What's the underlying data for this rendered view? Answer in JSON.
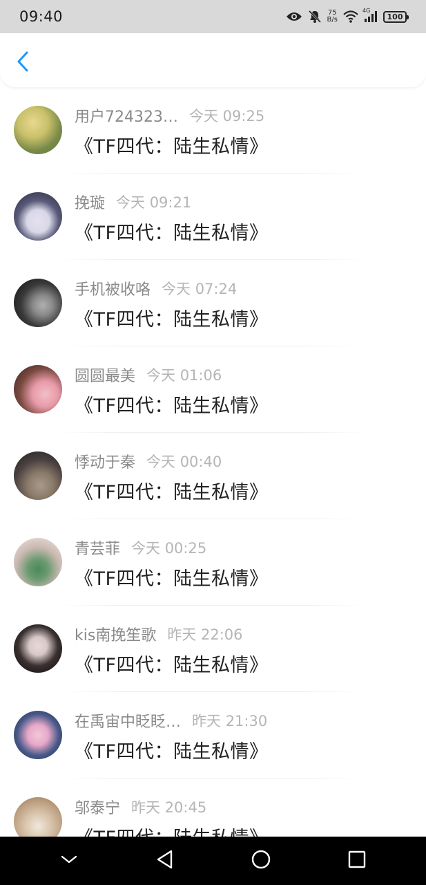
{
  "status_bar": {
    "time": "09:40",
    "net_speed_value": "75",
    "net_speed_unit": "B/s",
    "network_label": "4G",
    "battery": "100"
  },
  "header": {
    "back_icon": "chevron-left-icon",
    "accent_color": "#2196f3"
  },
  "messages": [
    {
      "name": "用户724323…",
      "time": "今天 09:25",
      "text": "《TF四代：陆生私情》",
      "avatar_colors": [
        "#c9c06a",
        "#5a7a3a"
      ]
    },
    {
      "name": "挽璇",
      "time": "今天 09:21",
      "text": "《TF四代：陆生私情》",
      "avatar_colors": [
        "#2a2a3a",
        "#d8d8e8"
      ]
    },
    {
      "name": "手机被收咯",
      "time": "今天 07:24",
      "text": "《TF四代：陆生私情》",
      "avatar_colors": [
        "#101010",
        "#8a8a8a"
      ]
    },
    {
      "name": "圆圆最美",
      "time": "今天 01:06",
      "text": "《TF四代：陆生私情》",
      "avatar_colors": [
        "#3a2020",
        "#e89aa8"
      ]
    },
    {
      "name": "悸动于秦",
      "time": "今天 00:40",
      "text": "《TF四代：陆生私情》",
      "avatar_colors": [
        "#202020",
        "#8a7a6a"
      ]
    },
    {
      "name": "青芸菲",
      "time": "今天 00:25",
      "text": "《TF四代：陆生私情》",
      "avatar_colors": [
        "#f0e8e0",
        "#4a8a5a"
      ]
    },
    {
      "name": "kis南挽笙歌",
      "time": "昨天 22:06",
      "text": "《TF四代：陆生私情》",
      "avatar_colors": [
        "#0a0a0a",
        "#d8c8c8"
      ]
    },
    {
      "name": "在禹宙中眨眨…",
      "time": "昨天 21:30",
      "text": "《TF四代：陆生私情》",
      "avatar_colors": [
        "#1a2a4a",
        "#e8a8c8"
      ]
    },
    {
      "name": "邬泰宁",
      "time": "昨天 20:45",
      "text": "《TF四代：陆生私情》",
      "avatar_colors": [
        "#b89a7a",
        "#f0e8dc"
      ]
    }
  ],
  "nav": {
    "items": [
      "chevron-down-icon",
      "back-triangle-icon",
      "home-circle-icon",
      "recents-square-icon"
    ]
  }
}
